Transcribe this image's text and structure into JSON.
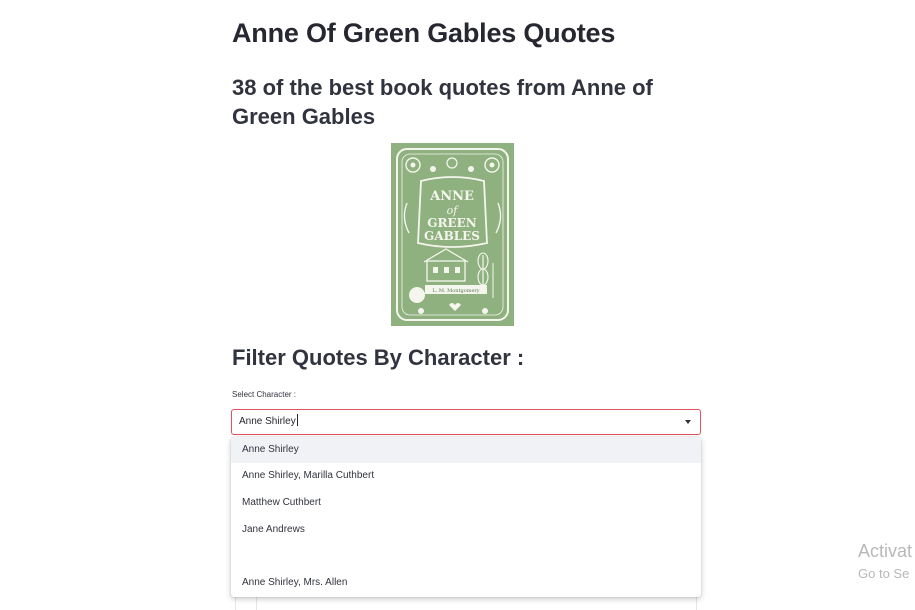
{
  "header": {
    "title": "Anne Of Green Gables Quotes",
    "subtitle": "38 of the best book quotes from Anne of Green Gables"
  },
  "cover": {
    "title_line1": "ANNE",
    "title_line2": "of",
    "title_line3": "GREEN",
    "title_line4": "GABLES",
    "author": "L. M. Montgomery",
    "background_color": "#8fb07f",
    "paper_color": "#f4f6ee"
  },
  "filter": {
    "heading": "Filter Quotes By Character :",
    "label": "Select Character :",
    "value": "Anne Shirley",
    "border_color": "#e0525c"
  },
  "dropdown": {
    "options": [
      "Anne Shirley",
      "Anne Shirley, Marilla Cuthbert",
      "Matthew Cuthbert",
      "Jane Andrews",
      "",
      "Anne Shirley, Mrs. Allen"
    ],
    "highlighted_index": 0
  },
  "watermark": {
    "line1": "Activat",
    "line2": "Go to Se"
  }
}
